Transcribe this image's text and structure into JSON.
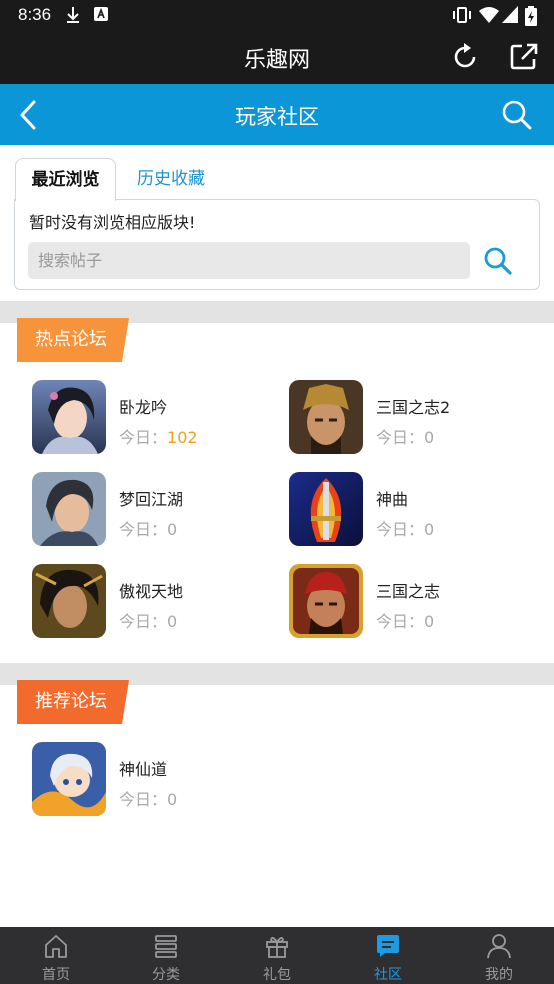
{
  "status_bar": {
    "time": "8:36",
    "colors": {
      "bg": "#1a1a1a"
    }
  },
  "app_bar": {
    "title": "乐趣网",
    "icons": [
      "refresh-icon",
      "share-icon"
    ]
  },
  "nav_bar": {
    "title": "玩家社区",
    "color": "#0b96d8",
    "icons": [
      "back-icon",
      "search-icon"
    ]
  },
  "recent_panel": {
    "tabs": [
      {
        "label": "最近浏览",
        "active": true
      },
      {
        "label": "历史收藏",
        "active": false
      }
    ],
    "empty_text": "暂时没有浏览相应版块!",
    "search_placeholder": "搜索帖子"
  },
  "hot_section": {
    "label": "热点论坛",
    "label_color": "#f7933a",
    "forums": [
      {
        "name": "卧龙吟",
        "today_label": "今日：",
        "count": "102",
        "highlight": true
      },
      {
        "name": "三国之志2",
        "today_label": "今日：",
        "count": "0"
      },
      {
        "name": "梦回江湖",
        "today_label": "今日：",
        "count": "0"
      },
      {
        "name": "神曲",
        "today_label": "今日：",
        "count": "0"
      },
      {
        "name": "傲视天地",
        "today_label": "今日：",
        "count": "0"
      },
      {
        "name": "三国之志",
        "today_label": "今日：",
        "count": "0"
      }
    ]
  },
  "recommend_section": {
    "label": "推荐论坛",
    "label_color": "#f26b2d",
    "forums": [
      {
        "name": "神仙道",
        "today_label": "今日：",
        "count": "0"
      }
    ]
  },
  "bottom_nav": {
    "items": [
      {
        "label": "首页",
        "icon": "home-icon"
      },
      {
        "label": "分类",
        "icon": "category-icon"
      },
      {
        "label": "礼包",
        "icon": "gift-icon"
      },
      {
        "label": "社区",
        "icon": "community-icon",
        "active": true
      },
      {
        "label": "我的",
        "icon": "user-icon"
      }
    ],
    "active_color": "#1e9be0"
  }
}
